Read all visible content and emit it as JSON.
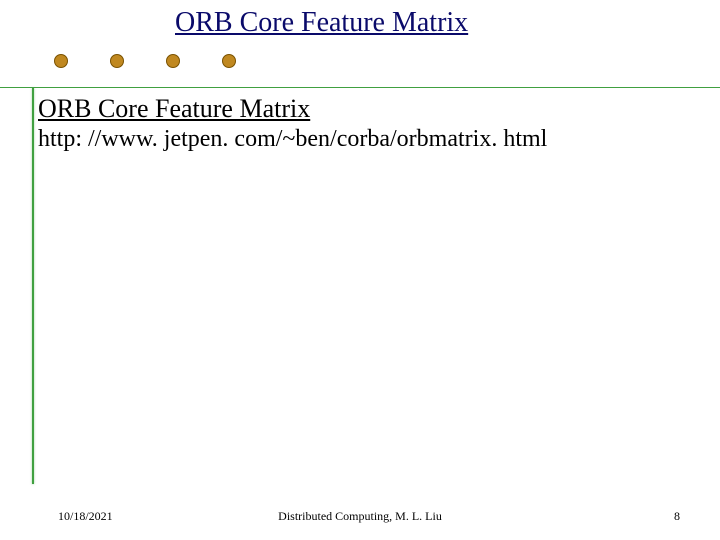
{
  "title": "ORB Core Feature Matrix",
  "subtitle": "ORB Core Feature Matrix",
  "url_text": "http: //www. jetpen. com/~ben/corba/orbmatrix. html",
  "footer": {
    "date": "10/18/2021",
    "center": "Distributed Computing, M. L. Liu",
    "page": "8"
  },
  "colors": {
    "title_color": "#0a0a6a",
    "line_color": "#40a040",
    "bullet_fill": "#c08820"
  }
}
